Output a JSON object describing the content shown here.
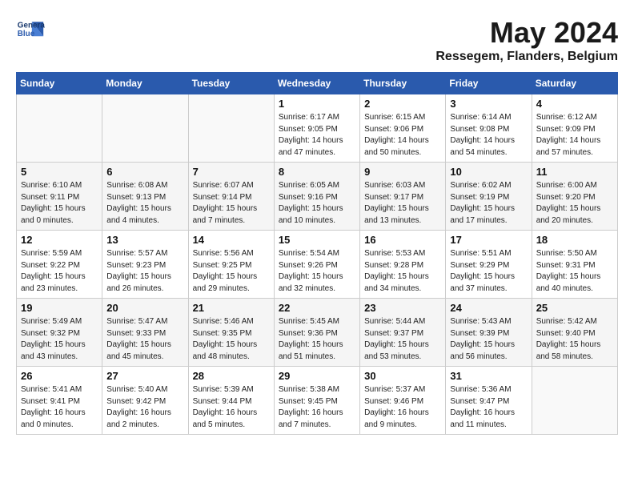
{
  "logo": {
    "line1": "General",
    "line2": "Blue"
  },
  "title": "May 2024",
  "location": "Ressegem, Flanders, Belgium",
  "headers": [
    "Sunday",
    "Monday",
    "Tuesday",
    "Wednesday",
    "Thursday",
    "Friday",
    "Saturday"
  ],
  "weeks": [
    [
      {
        "day": "",
        "detail": ""
      },
      {
        "day": "",
        "detail": ""
      },
      {
        "day": "",
        "detail": ""
      },
      {
        "day": "1",
        "detail": "Sunrise: 6:17 AM\nSunset: 9:05 PM\nDaylight: 14 hours and 47 minutes."
      },
      {
        "day": "2",
        "detail": "Sunrise: 6:15 AM\nSunset: 9:06 PM\nDaylight: 14 hours and 50 minutes."
      },
      {
        "day": "3",
        "detail": "Sunrise: 6:14 AM\nSunset: 9:08 PM\nDaylight: 14 hours and 54 minutes."
      },
      {
        "day": "4",
        "detail": "Sunrise: 6:12 AM\nSunset: 9:09 PM\nDaylight: 14 hours and 57 minutes."
      }
    ],
    [
      {
        "day": "5",
        "detail": "Sunrise: 6:10 AM\nSunset: 9:11 PM\nDaylight: 15 hours and 0 minutes."
      },
      {
        "day": "6",
        "detail": "Sunrise: 6:08 AM\nSunset: 9:13 PM\nDaylight: 15 hours and 4 minutes."
      },
      {
        "day": "7",
        "detail": "Sunrise: 6:07 AM\nSunset: 9:14 PM\nDaylight: 15 hours and 7 minutes."
      },
      {
        "day": "8",
        "detail": "Sunrise: 6:05 AM\nSunset: 9:16 PM\nDaylight: 15 hours and 10 minutes."
      },
      {
        "day": "9",
        "detail": "Sunrise: 6:03 AM\nSunset: 9:17 PM\nDaylight: 15 hours and 13 minutes."
      },
      {
        "day": "10",
        "detail": "Sunrise: 6:02 AM\nSunset: 9:19 PM\nDaylight: 15 hours and 17 minutes."
      },
      {
        "day": "11",
        "detail": "Sunrise: 6:00 AM\nSunset: 9:20 PM\nDaylight: 15 hours and 20 minutes."
      }
    ],
    [
      {
        "day": "12",
        "detail": "Sunrise: 5:59 AM\nSunset: 9:22 PM\nDaylight: 15 hours and 23 minutes."
      },
      {
        "day": "13",
        "detail": "Sunrise: 5:57 AM\nSunset: 9:23 PM\nDaylight: 15 hours and 26 minutes."
      },
      {
        "day": "14",
        "detail": "Sunrise: 5:56 AM\nSunset: 9:25 PM\nDaylight: 15 hours and 29 minutes."
      },
      {
        "day": "15",
        "detail": "Sunrise: 5:54 AM\nSunset: 9:26 PM\nDaylight: 15 hours and 32 minutes."
      },
      {
        "day": "16",
        "detail": "Sunrise: 5:53 AM\nSunset: 9:28 PM\nDaylight: 15 hours and 34 minutes."
      },
      {
        "day": "17",
        "detail": "Sunrise: 5:51 AM\nSunset: 9:29 PM\nDaylight: 15 hours and 37 minutes."
      },
      {
        "day": "18",
        "detail": "Sunrise: 5:50 AM\nSunset: 9:31 PM\nDaylight: 15 hours and 40 minutes."
      }
    ],
    [
      {
        "day": "19",
        "detail": "Sunrise: 5:49 AM\nSunset: 9:32 PM\nDaylight: 15 hours and 43 minutes."
      },
      {
        "day": "20",
        "detail": "Sunrise: 5:47 AM\nSunset: 9:33 PM\nDaylight: 15 hours and 45 minutes."
      },
      {
        "day": "21",
        "detail": "Sunrise: 5:46 AM\nSunset: 9:35 PM\nDaylight: 15 hours and 48 minutes."
      },
      {
        "day": "22",
        "detail": "Sunrise: 5:45 AM\nSunset: 9:36 PM\nDaylight: 15 hours and 51 minutes."
      },
      {
        "day": "23",
        "detail": "Sunrise: 5:44 AM\nSunset: 9:37 PM\nDaylight: 15 hours and 53 minutes."
      },
      {
        "day": "24",
        "detail": "Sunrise: 5:43 AM\nSunset: 9:39 PM\nDaylight: 15 hours and 56 minutes."
      },
      {
        "day": "25",
        "detail": "Sunrise: 5:42 AM\nSunset: 9:40 PM\nDaylight: 15 hours and 58 minutes."
      }
    ],
    [
      {
        "day": "26",
        "detail": "Sunrise: 5:41 AM\nSunset: 9:41 PM\nDaylight: 16 hours and 0 minutes."
      },
      {
        "day": "27",
        "detail": "Sunrise: 5:40 AM\nSunset: 9:42 PM\nDaylight: 16 hours and 2 minutes."
      },
      {
        "day": "28",
        "detail": "Sunrise: 5:39 AM\nSunset: 9:44 PM\nDaylight: 16 hours and 5 minutes."
      },
      {
        "day": "29",
        "detail": "Sunrise: 5:38 AM\nSunset: 9:45 PM\nDaylight: 16 hours and 7 minutes."
      },
      {
        "day": "30",
        "detail": "Sunrise: 5:37 AM\nSunset: 9:46 PM\nDaylight: 16 hours and 9 minutes."
      },
      {
        "day": "31",
        "detail": "Sunrise: 5:36 AM\nSunset: 9:47 PM\nDaylight: 16 hours and 11 minutes."
      },
      {
        "day": "",
        "detail": ""
      }
    ]
  ]
}
